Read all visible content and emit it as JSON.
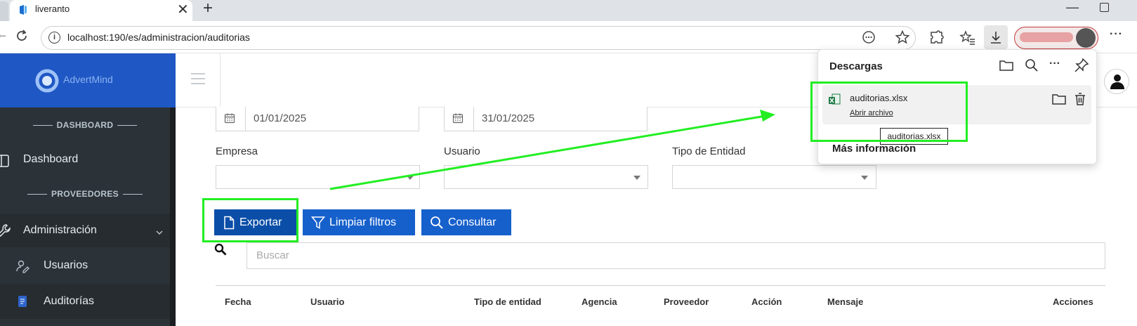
{
  "browser": {
    "tab_title": "liveranto",
    "url": "localhost:190/es/administracion/auditorias"
  },
  "sidebar": {
    "logo_text": "AdvertMind",
    "section_dashboard": "DASHBOARD",
    "section_proveedores": "PROVEEDORES",
    "items": [
      {
        "label": "Dashboard",
        "icon": "layout-icon"
      },
      {
        "label": "Administración",
        "icon": "wrench-icon"
      },
      {
        "label": "Usuarios",
        "icon": "user-edit-icon"
      },
      {
        "label": "Auditorías",
        "icon": "document-icon"
      }
    ]
  },
  "filters": {
    "date_from": "01/01/2025",
    "date_to": "31/01/2025",
    "empresa_label": "Empresa",
    "usuario_label": "Usuario",
    "tipo_entidad_label": "Tipo de Entidad"
  },
  "actions": {
    "export": "Exportar",
    "clear_filters": "Limpiar filtros",
    "query": "Consultar"
  },
  "search": {
    "placeholder": "Buscar"
  },
  "table": {
    "headers": [
      "Fecha",
      "Usuario",
      "Tipo de entidad",
      "Agencia",
      "Proveedor",
      "Acción",
      "Mensaje",
      "Acciones"
    ]
  },
  "downloads": {
    "title": "Descargas",
    "file_name": "auditorias.xlsx",
    "open_file": "Abrir archivo",
    "tooltip": "auditorias.xlsx",
    "more_info": "Más información"
  },
  "colors": {
    "brand_blue": "#1f57c4",
    "button_blue": "#1660cc",
    "sidebar_bg": "#2c3338",
    "annotation_green": "#22ee22"
  }
}
